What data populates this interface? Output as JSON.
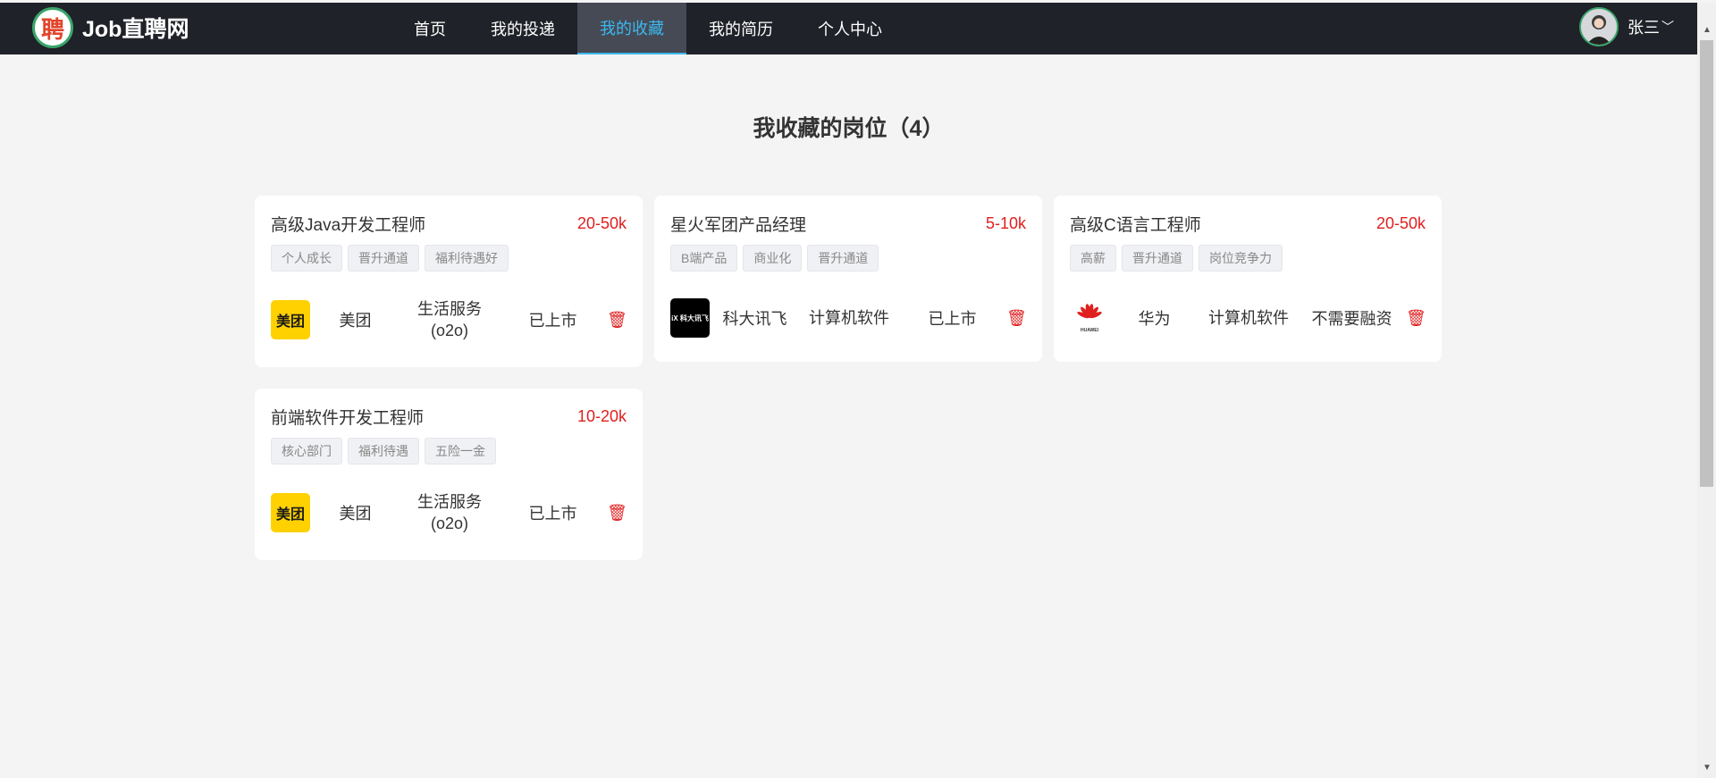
{
  "header": {
    "logo_glyph": "聘",
    "site_name": "Job直聘网",
    "nav": [
      {
        "label": "首页",
        "active": false
      },
      {
        "label": "我的投递",
        "active": false
      },
      {
        "label": "我的收藏",
        "active": true
      },
      {
        "label": "我的简历",
        "active": false
      },
      {
        "label": "个人中心",
        "active": false
      }
    ],
    "user_name": "张三"
  },
  "main": {
    "title": "我收藏的岗位（4）"
  },
  "cards": [
    {
      "title": "高级Java开发工程师",
      "salary": "20-50k",
      "tags": [
        "个人成长",
        "晋升通道",
        "福利待遇好"
      ],
      "company": {
        "logo": "美团",
        "name": "美团",
        "industry": "生活服务(o2o)",
        "stage": "已上市"
      }
    },
    {
      "title": "星火军团产品经理",
      "salary": "5-10k",
      "tags": [
        "B端产品",
        "商业化",
        "晋升通道"
      ],
      "company": {
        "logo": "iX 科大讯飞",
        "name": "科大讯飞",
        "industry": "计算机软件",
        "stage": "已上市"
      }
    },
    {
      "title": "高级C语言工程师",
      "salary": "20-50k",
      "tags": [
        "高薪",
        "晋升通道",
        "岗位竞争力"
      ],
      "company": {
        "logo": "HUAWEI",
        "name": "华为",
        "industry": "计算机软件",
        "stage": "不需要融资"
      }
    },
    {
      "title": "前端软件开发工程师",
      "salary": "10-20k",
      "tags": [
        "核心部门",
        "福利待遇",
        "五险一金"
      ],
      "company": {
        "logo": "美团",
        "name": "美团",
        "industry": "生活服务(o2o)",
        "stage": "已上市"
      }
    }
  ],
  "colors": {
    "header_bg": "#1f2228",
    "nav_active": "#3db8ee",
    "salary": "#e01e1e",
    "page_bg": "#f4f4f5"
  }
}
